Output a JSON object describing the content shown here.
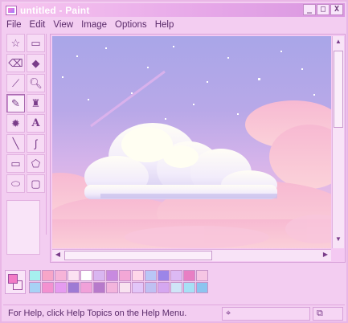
{
  "window": {
    "title": "untitled - Paint",
    "controls": [
      "_",
      "□",
      "X"
    ]
  },
  "menu": [
    {
      "label": "File"
    },
    {
      "label": "Edit"
    },
    {
      "label": "View"
    },
    {
      "label": "Image"
    },
    {
      "label": "Options"
    },
    {
      "label": "Help"
    }
  ],
  "tools": [
    {
      "name": "free-form-select",
      "glyph": "☆"
    },
    {
      "name": "select",
      "glyph": "▭"
    },
    {
      "name": "eraser",
      "glyph": "⌫"
    },
    {
      "name": "fill-with-color",
      "glyph": "◆"
    },
    {
      "name": "pick-color",
      "glyph": "⟋"
    },
    {
      "name": "magnifier",
      "glyph": "🔍︎"
    },
    {
      "name": "pencil",
      "glyph": "✎"
    },
    {
      "name": "brush",
      "glyph": "♜"
    },
    {
      "name": "airbrush",
      "glyph": "✹"
    },
    {
      "name": "text",
      "glyph": "A"
    },
    {
      "name": "line",
      "glyph": "╲"
    },
    {
      "name": "curve",
      "glyph": "∫"
    },
    {
      "name": "rectangle",
      "glyph": "▭"
    },
    {
      "name": "polygon",
      "glyph": "⬠"
    },
    {
      "name": "ellipse",
      "glyph": "⬭"
    },
    {
      "name": "rounded-rectangle",
      "glyph": "▢"
    }
  ],
  "palette": {
    "foreground": "#f27bc6",
    "background": "#fde6f8",
    "colors": [
      "#a6f0ee",
      "#f7a6c8",
      "#f6b4d8",
      "#fbe2f2",
      "#ffffff",
      "#d9b6f0",
      "#c88ae0",
      "#f3a7d6",
      "#ffd7e9",
      "#b9c6f6",
      "#9c85e8",
      "#dcb9f4",
      "#e87fc4",
      "#f6c6e4",
      "#a7d2f5",
      "#f391d0",
      "#e59bf0",
      "#9e7ad4",
      "#f1a1d9",
      "#b77acb",
      "#f3b4dc",
      "#f8e2f0",
      "#e2c6f8",
      "#bfc0f2",
      "#d5a7f0",
      "#cfe5f7",
      "#a7e0f5",
      "#8cc4ef"
    ]
  },
  "statusbar": {
    "help_text": "For Help, click Help Topics on the Help Menu."
  }
}
